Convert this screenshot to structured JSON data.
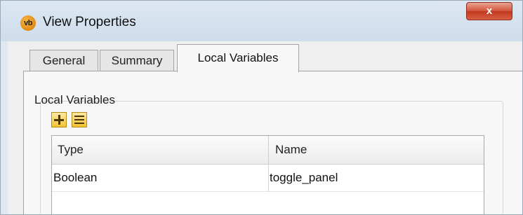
{
  "window": {
    "title": "View Properties",
    "app_icon_text": "vb",
    "close_label": "x"
  },
  "tabs": [
    {
      "label": "General",
      "selected": false
    },
    {
      "label": "Summary",
      "selected": false
    },
    {
      "label": "Local Variables",
      "selected": true
    }
  ],
  "local_variables": {
    "group_label": "Local Variables",
    "toolbar": [
      {
        "icon": "add-icon"
      },
      {
        "icon": "list-icon"
      }
    ],
    "columns": [
      "Type",
      "Name"
    ],
    "rows": [
      {
        "type": "Boolean",
        "name": "toggle_panel"
      }
    ]
  }
}
